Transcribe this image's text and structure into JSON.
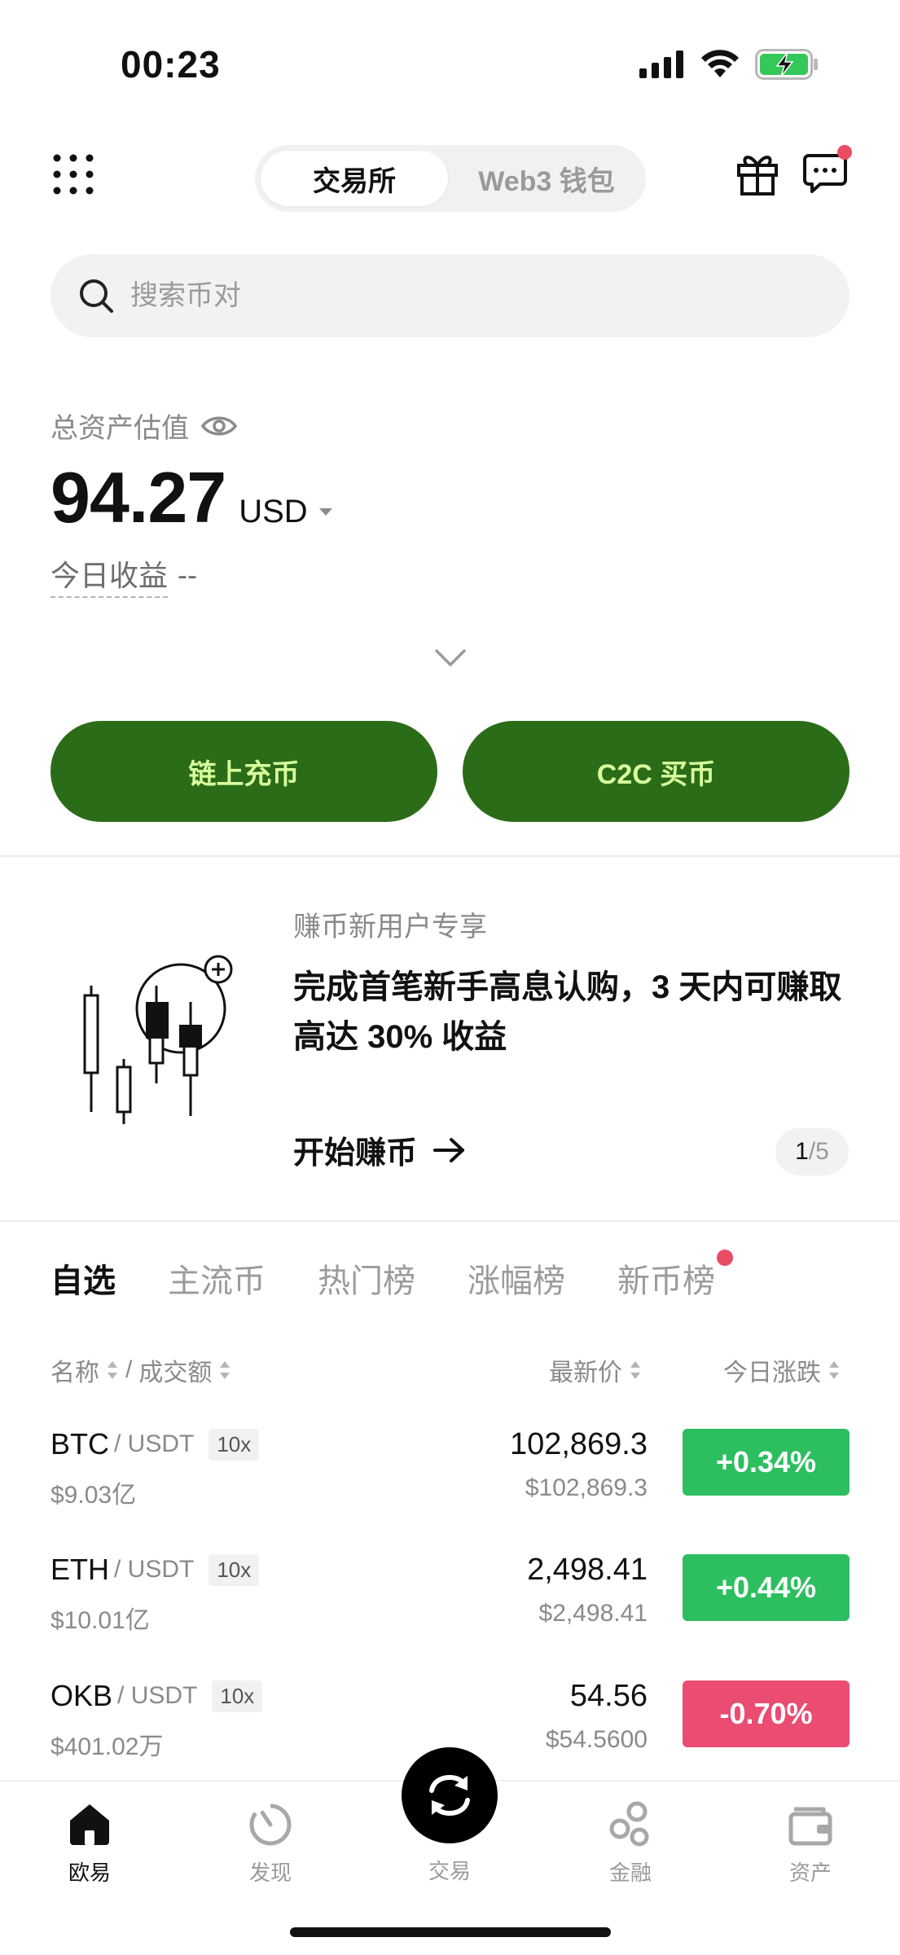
{
  "status_bar": {
    "time": "00:23"
  },
  "header": {
    "tabs": [
      {
        "label": "交易所",
        "active": true
      },
      {
        "label": "Web3 钱包",
        "active": false
      }
    ]
  },
  "search": {
    "placeholder": "搜索币对"
  },
  "assets": {
    "label": "总资产估值",
    "value": "94.27",
    "currency": "USD",
    "today_label": "今日收益",
    "today_value": "--"
  },
  "actions": {
    "deposit_label": "链上充币",
    "c2c_label": "C2C 买币"
  },
  "promo": {
    "subtitle": "赚币新用户专享",
    "title": "完成首笔新手高息认购，3 天内可赚取高达 30% 收益",
    "cta": "开始赚币",
    "page_current": "1",
    "page_total": "/5"
  },
  "market": {
    "tabs": [
      "自选",
      "主流币",
      "热门榜",
      "涨幅榜",
      "新币榜"
    ],
    "col_name": "名称",
    "col_sep": "/",
    "col_volume": "成交额",
    "col_price": "最新价",
    "col_change": "今日涨跌",
    "rows": [
      {
        "base": "BTC",
        "quote": "/ USDT",
        "lev": "10x",
        "volume": "$9.03亿",
        "price": "102,869.3",
        "price_usd": "$102,869.3",
        "change": "+0.34%",
        "dir": "up"
      },
      {
        "base": "ETH",
        "quote": "/ USDT",
        "lev": "10x",
        "volume": "$10.01亿",
        "price": "2,498.41",
        "price_usd": "$2,498.41",
        "change": "+0.44%",
        "dir": "up"
      },
      {
        "base": "OKB",
        "quote": "/ USDT",
        "lev": "10x",
        "volume": "$401.02万",
        "price": "54.56",
        "price_usd": "$54.5600",
        "change": "-0.70%",
        "dir": "down"
      }
    ]
  },
  "nav": {
    "items": [
      {
        "label": "欧易",
        "icon": "home-icon",
        "active": true
      },
      {
        "label": "发现",
        "icon": "discover-icon",
        "active": false
      },
      {
        "label": "交易",
        "icon": "trade-icon",
        "active": false
      },
      {
        "label": "金融",
        "icon": "finance-icon",
        "active": false
      },
      {
        "label": "资产",
        "icon": "wallet-icon",
        "active": false
      }
    ]
  },
  "colors": {
    "brand_green": "#2b6c19",
    "button_text": "#d8ff9c",
    "up": "#2dbe60",
    "down": "#ea4c72",
    "badge_red": "#ea4c63"
  }
}
